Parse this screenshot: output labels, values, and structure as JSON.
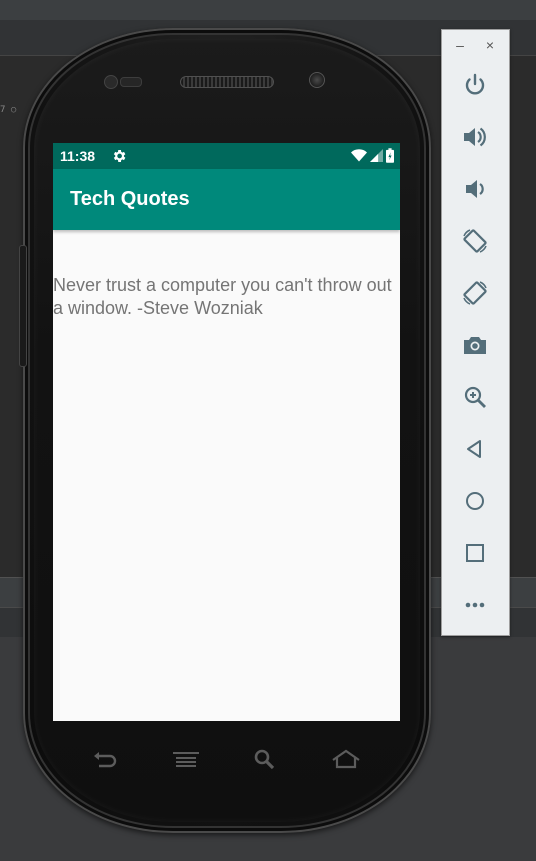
{
  "ide": {
    "fragment_text": "7  ○"
  },
  "device": {
    "status_bar": {
      "time": "11:38",
      "icons": [
        "settings-icon",
        "wifi-icon",
        "signal-icon",
        "battery-icon"
      ]
    },
    "app_bar": {
      "title": "Tech Quotes"
    },
    "content": {
      "quote": "Never trust a computer you can't throw out a window. -Steve Wozniak"
    },
    "nav_buttons": [
      "back-icon",
      "menu-icon",
      "search-icon",
      "home-icon"
    ]
  },
  "emulator_panel": {
    "window_controls": {
      "minimize": "–",
      "close": "×"
    },
    "tools": [
      "power-icon",
      "volume-up-icon",
      "volume-down-icon",
      "rotate-left-icon",
      "rotate-right-icon",
      "screenshot-icon",
      "zoom-icon",
      "back-icon",
      "home-icon",
      "overview-icon",
      "more-icon"
    ]
  },
  "colors": {
    "status_bar": "#00695c",
    "app_bar": "#00897b",
    "quote_text": "#757575",
    "screen_bg": "#fafafa",
    "emulator_icon": "#546e7a"
  }
}
